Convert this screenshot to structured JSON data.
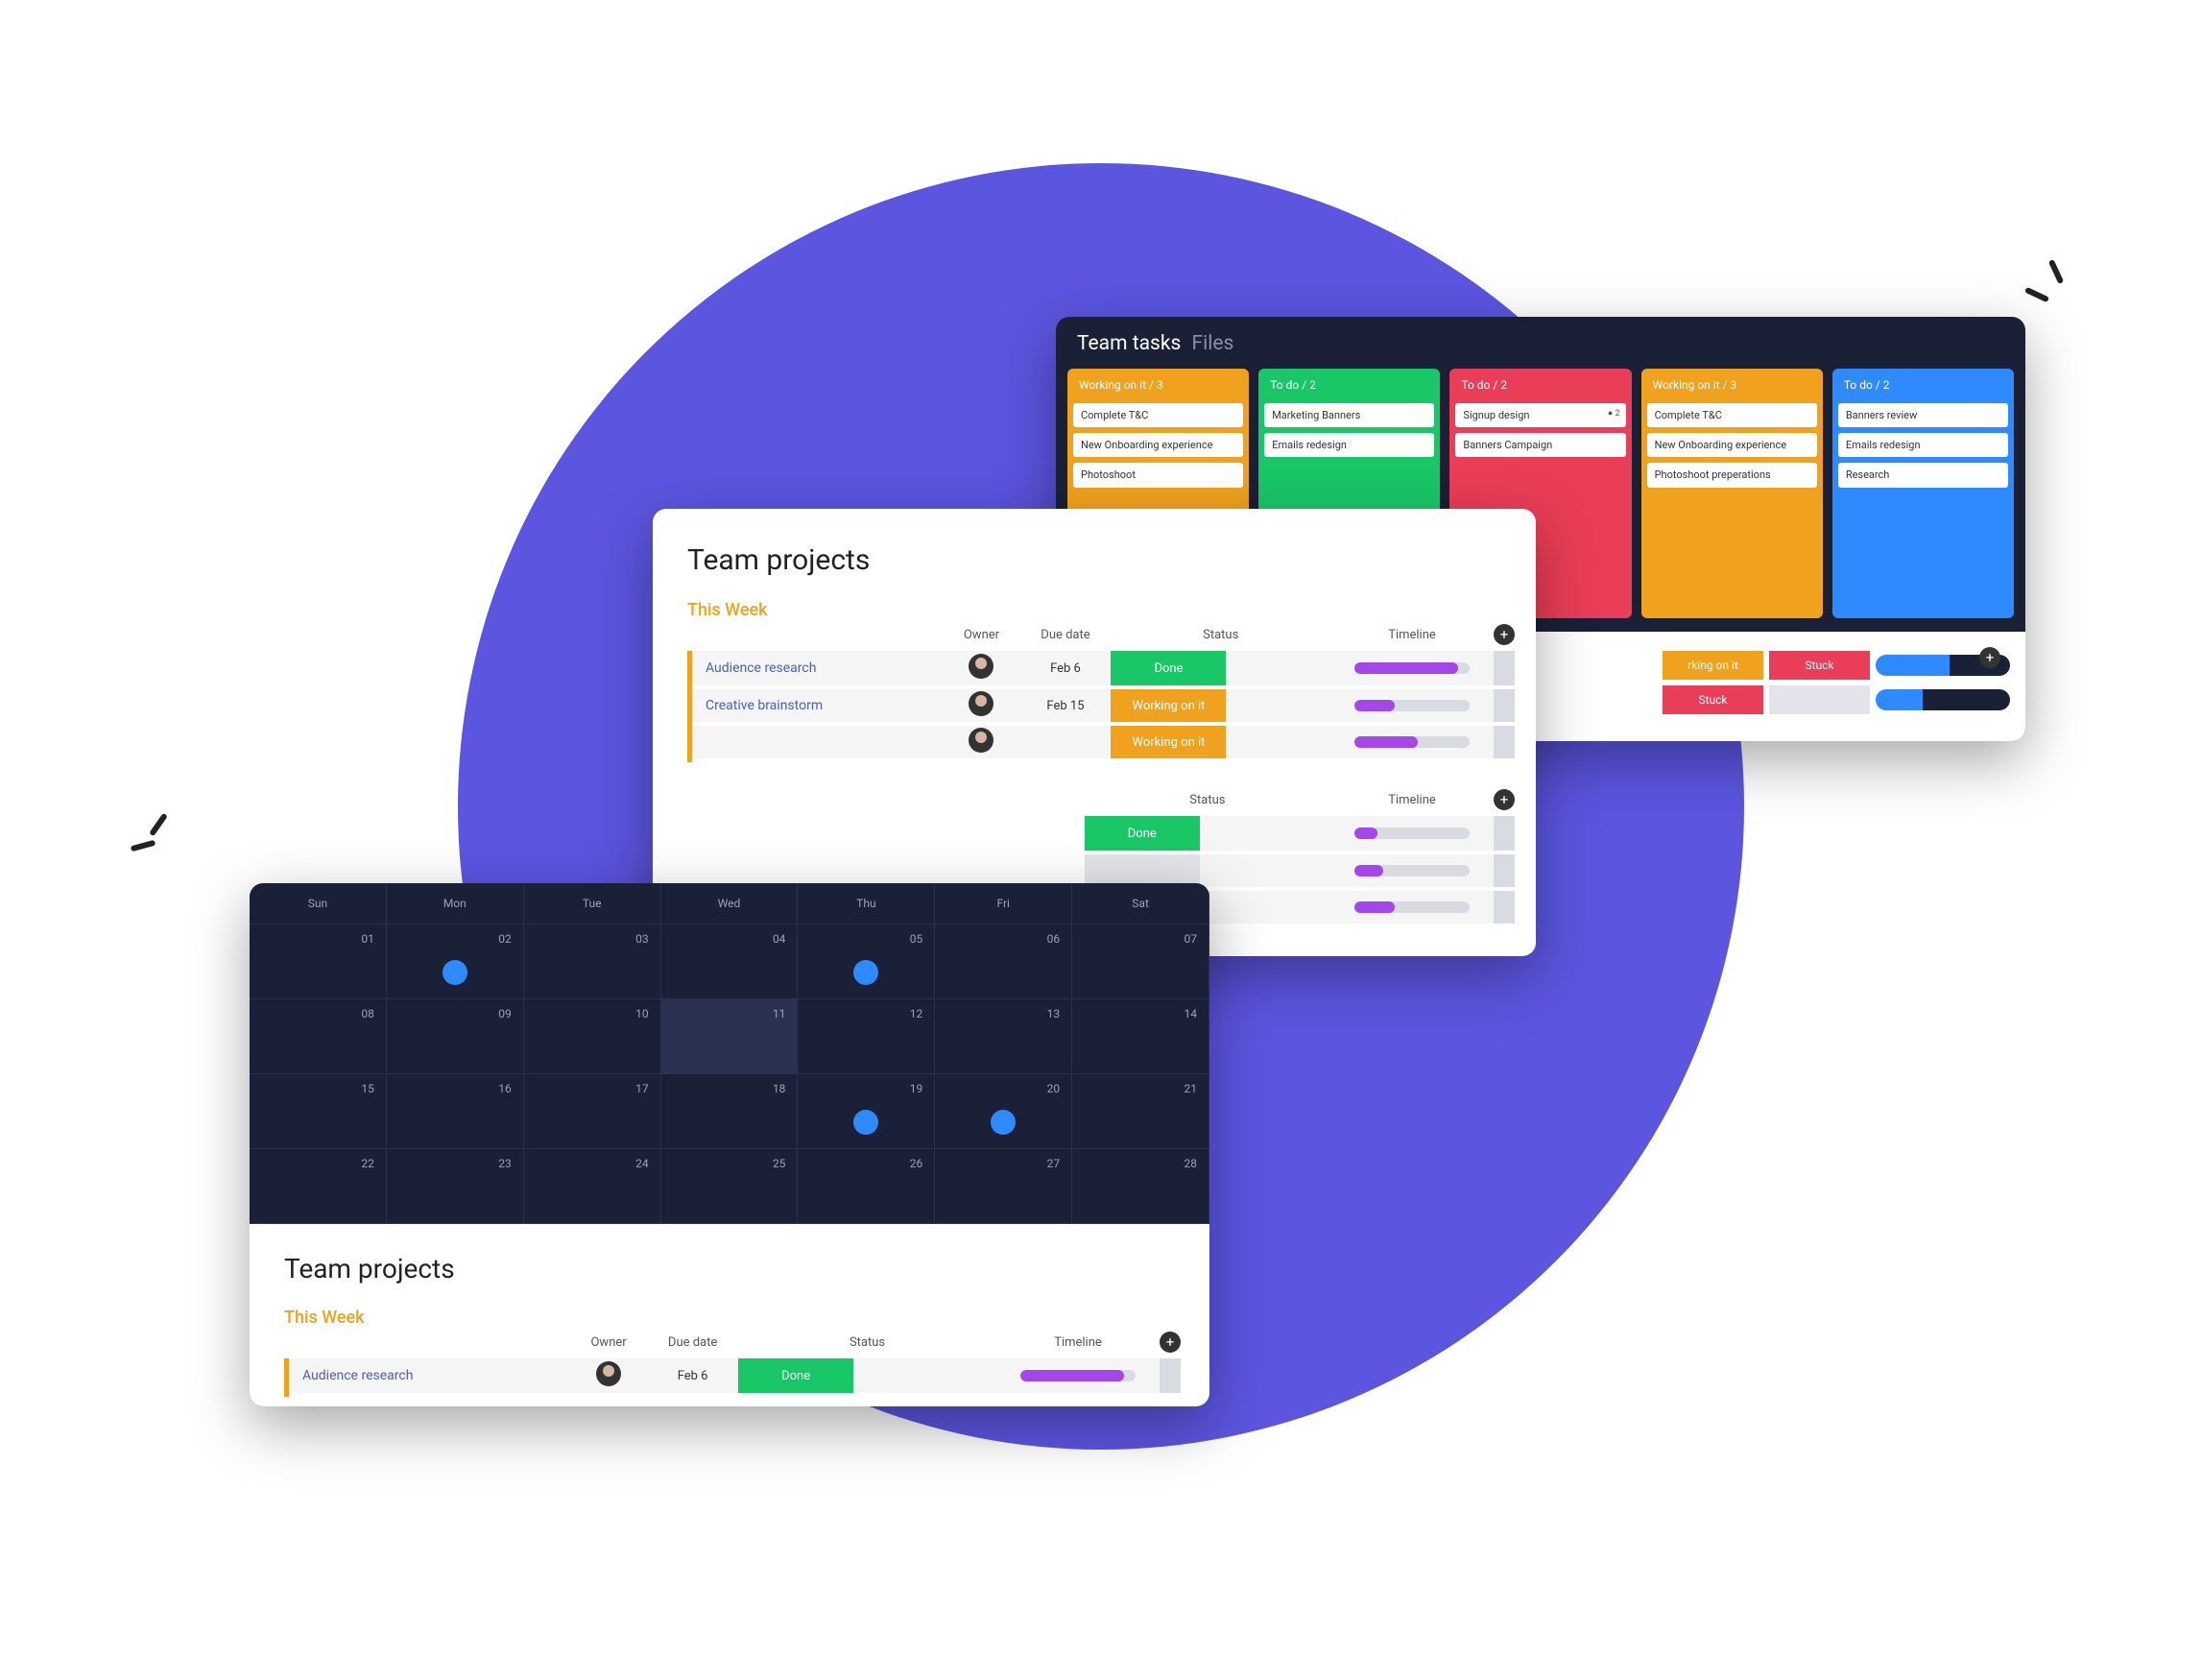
{
  "colors": {
    "accent_purple": "#5b55e0",
    "orange": "#f0a21e",
    "green": "#19c767",
    "red": "#ea3d57",
    "blue": "#2f8aff",
    "navy": "#1a2036",
    "lilac": "#a446e8"
  },
  "kanban": {
    "title": "Team tasks",
    "subtitle": "Files",
    "columns": [
      {
        "label": "Working on it / 3",
        "color": "orange",
        "cards": [
          "Complete T&C",
          "New Onboarding experience",
          "Photoshoot"
        ]
      },
      {
        "label": "To do / 2",
        "color": "green",
        "cards": [
          "Marketing Banners",
          "Emails redesign"
        ]
      },
      {
        "label": "To do / 2",
        "color": "red",
        "cards": [
          "Signup design",
          "Banners Campaign"
        ],
        "note_on_first": "● 2"
      },
      {
        "label": "Working on it / 3",
        "color": "orange",
        "cards": [
          "Complete T&C",
          "New Onboarding experience",
          "Photoshoot preperations"
        ]
      },
      {
        "label": "To do / 2",
        "color": "blue",
        "cards": [
          "Banners review",
          "Emails redesign",
          "Research"
        ]
      }
    ],
    "summary": {
      "rows": [
        {
          "cells": [
            {
              "label": "rking on it",
              "color": "orange"
            },
            {
              "label": "Stuck",
              "color": "red"
            }
          ],
          "bar_segments": [
            {
              "color": "blue",
              "pct": 55
            },
            {
              "color": "navy",
              "pct": 45
            }
          ]
        },
        {
          "cells": [
            {
              "label": "Stuck",
              "color": "red"
            },
            {
              "label": "",
              "color": "grey"
            }
          ],
          "bar_segments": [
            {
              "color": "blue",
              "pct": 35
            },
            {
              "color": "navy",
              "pct": 65
            }
          ]
        }
      ]
    }
  },
  "projects": {
    "title": "Team projects",
    "section_label": "This Week",
    "headers": {
      "owner": "Owner",
      "due": "Due date",
      "status": "Status",
      "timeline": "Timeline"
    },
    "primary_rows": [
      {
        "task": "Audience research",
        "due": "Feb 6",
        "status": "Done",
        "status_color": "done",
        "tl_pct": 90
      },
      {
        "task": "Creative brainstorm",
        "due": "Feb 15",
        "status": "Working on it",
        "status_color": "working",
        "tl_pct": 35
      },
      {
        "task": "",
        "due": "",
        "status": "Working on it",
        "status_color": "working",
        "tl_pct": 55
      }
    ],
    "secondary": {
      "headers": {
        "status": "Status",
        "timeline": "Timeline"
      },
      "rows": [
        {
          "status": "Done",
          "status_color": "done",
          "tl_pct": 20
        },
        {
          "status": "",
          "status_color": "",
          "tl_pct": 25
        },
        {
          "status": "",
          "status_color": "",
          "tl_pct": 35
        }
      ]
    }
  },
  "calendar": {
    "days": [
      "Sun",
      "Mon",
      "Tue",
      "Wed",
      "Thu",
      "Fri",
      "Sat"
    ],
    "weeks": [
      [
        {
          "n": "01"
        },
        {
          "n": "02",
          "dot": true
        },
        {
          "n": "03"
        },
        {
          "n": "04"
        },
        {
          "n": "05",
          "dot": true
        },
        {
          "n": "06"
        },
        {
          "n": "07"
        }
      ],
      [
        {
          "n": "08"
        },
        {
          "n": "09"
        },
        {
          "n": "10"
        },
        {
          "n": "11",
          "selected": true
        },
        {
          "n": "12"
        },
        {
          "n": "13"
        },
        {
          "n": "14"
        }
      ],
      [
        {
          "n": "15"
        },
        {
          "n": "16"
        },
        {
          "n": "17"
        },
        {
          "n": "18"
        },
        {
          "n": "19",
          "dot": true
        },
        {
          "n": "20",
          "dot": true
        },
        {
          "n": "21"
        }
      ],
      [
        {
          "n": "22"
        },
        {
          "n": "23"
        },
        {
          "n": "24"
        },
        {
          "n": "25"
        },
        {
          "n": "26"
        },
        {
          "n": "27"
        },
        {
          "n": "28"
        }
      ]
    ],
    "projects": {
      "title": "Team projects",
      "section_label": "This Week",
      "headers": {
        "owner": "Owner",
        "due": "Due date",
        "status": "Status",
        "timeline": "Timeline"
      },
      "rows": [
        {
          "task": "Audience research",
          "due": "Feb 6",
          "status": "Done",
          "status_color": "done",
          "tl_pct": 90
        }
      ]
    }
  }
}
